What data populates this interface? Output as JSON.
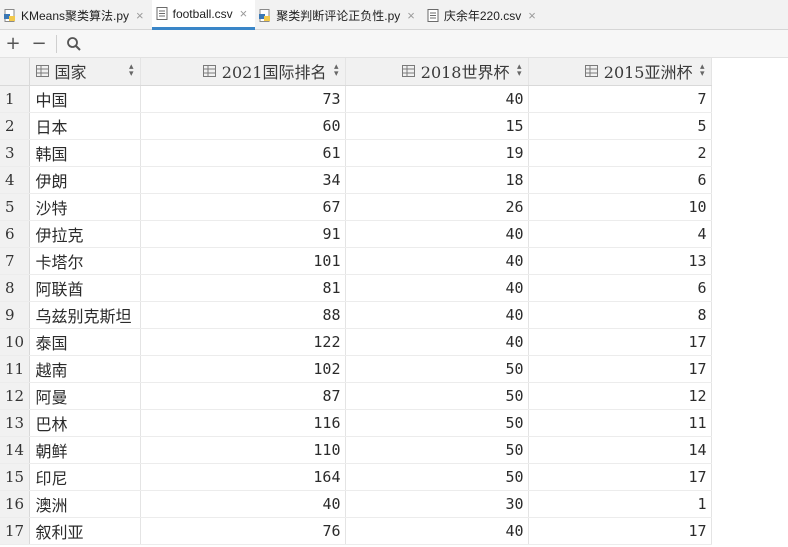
{
  "tabs": [
    {
      "label": "KMeans聚类算法.py",
      "type": "py",
      "active": false
    },
    {
      "label": "football.csv",
      "type": "csv",
      "active": true
    },
    {
      "label": "聚类判断评论正负性.py",
      "type": "py",
      "active": false
    },
    {
      "label": "庆余年220.csv",
      "type": "csv",
      "active": false
    }
  ],
  "toolbar": {
    "add_icon": "plus-icon",
    "remove_icon": "minus-icon",
    "search_icon": "search-icon"
  },
  "table": {
    "columns": [
      "国家",
      "2021国际排名",
      "2018世界杯",
      "2015亚洲杯"
    ],
    "rows": [
      [
        "1",
        "中国",
        "73",
        "40",
        "7"
      ],
      [
        "2",
        "日本",
        "60",
        "15",
        "5"
      ],
      [
        "3",
        "韩国",
        "61",
        "19",
        "2"
      ],
      [
        "4",
        "伊朗",
        "34",
        "18",
        "6"
      ],
      [
        "5",
        "沙特",
        "67",
        "26",
        "10"
      ],
      [
        "6",
        "伊拉克",
        "91",
        "40",
        "4"
      ],
      [
        "7",
        "卡塔尔",
        "101",
        "40",
        "13"
      ],
      [
        "8",
        "阿联酋",
        "81",
        "40",
        "6"
      ],
      [
        "9",
        "乌兹别克斯坦",
        "88",
        "40",
        "8"
      ],
      [
        "10",
        "泰国",
        "122",
        "40",
        "17"
      ],
      [
        "11",
        "越南",
        "102",
        "50",
        "17"
      ],
      [
        "12",
        "阿曼",
        "87",
        "50",
        "12"
      ],
      [
        "13",
        "巴林",
        "116",
        "50",
        "11"
      ],
      [
        "14",
        "朝鲜",
        "110",
        "50",
        "14"
      ],
      [
        "15",
        "印尼",
        "164",
        "50",
        "17"
      ],
      [
        "16",
        "澳洲",
        "40",
        "30",
        "1"
      ],
      [
        "17",
        "叙利亚",
        "76",
        "40",
        "17"
      ]
    ]
  },
  "colors": {
    "active_tab_underline": "#3a86c8",
    "header_bg": "#f1f1f1"
  }
}
